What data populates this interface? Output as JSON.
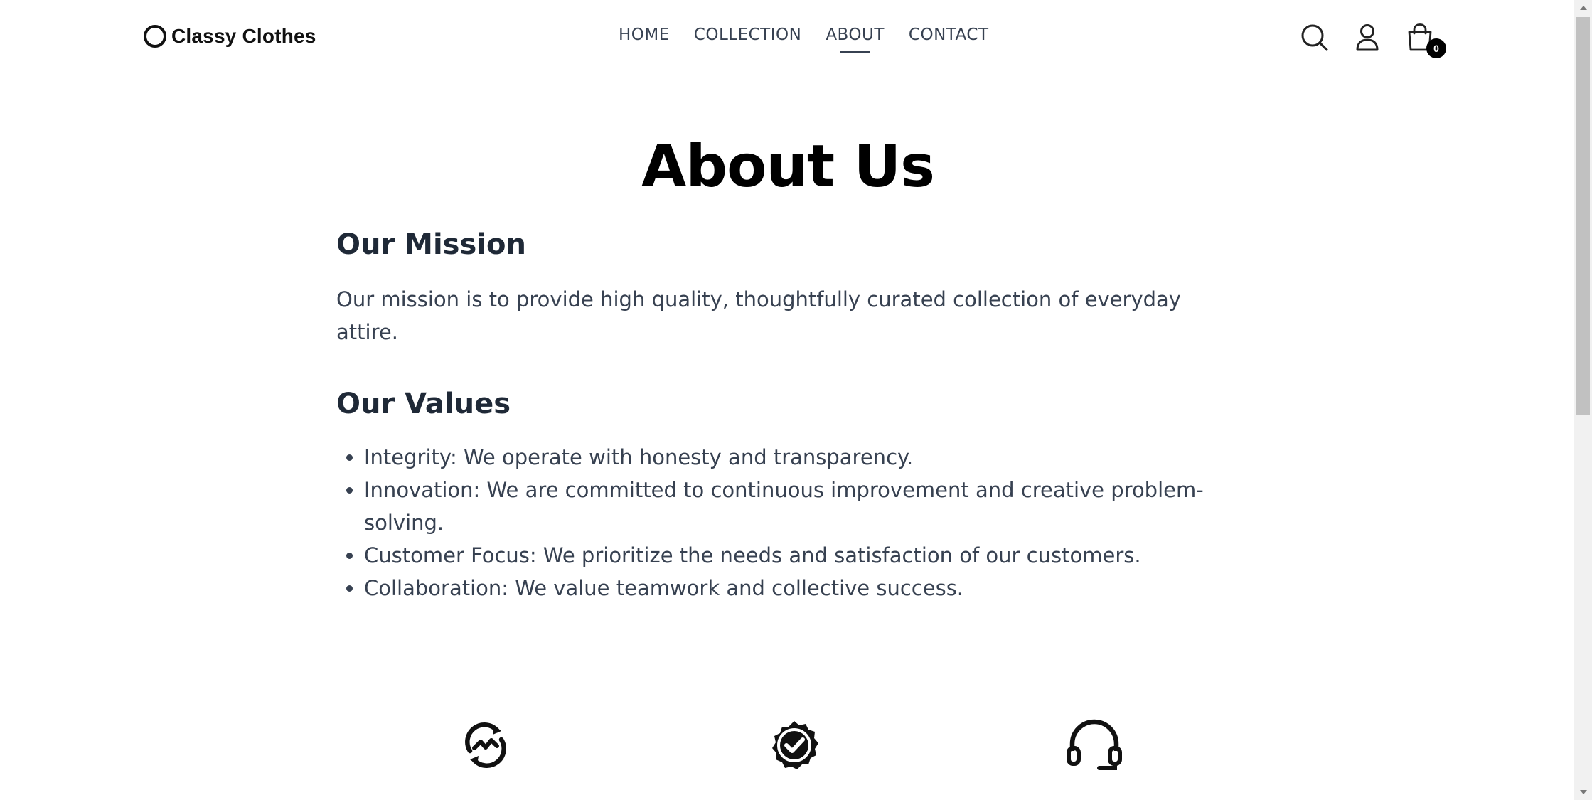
{
  "header": {
    "logo_text": "Classy Clothes",
    "nav": [
      {
        "label": "HOME",
        "active": false
      },
      {
        "label": "COLLECTION",
        "active": false
      },
      {
        "label": "ABOUT",
        "active": true
      },
      {
        "label": "CONTACT",
        "active": false
      }
    ],
    "icons": [
      "search-icon",
      "user-icon",
      "cart-icon"
    ],
    "cart_count": "0"
  },
  "main": {
    "title": "About Us",
    "mission": {
      "heading": "Our Mission",
      "text": "Our mission is to provide high quality, thoughtfully curated collection of everyday attire."
    },
    "values": {
      "heading": "Our Values",
      "items": [
        "Integrity: We operate with honesty and transparency.",
        "Innovation: We are committed to continuous improvement and creative problem-solving.",
        "Customer Focus: We prioritize the needs and satisfaction of our customers.",
        "Collaboration: We value teamwork and collective success."
      ]
    },
    "features": [
      "exchange-icon",
      "quality-badge-icon",
      "support-headset-icon"
    ]
  },
  "colors": {
    "text": "#374151",
    "heading": "#1f2937",
    "title": "#000000",
    "background": "#ffffff"
  }
}
